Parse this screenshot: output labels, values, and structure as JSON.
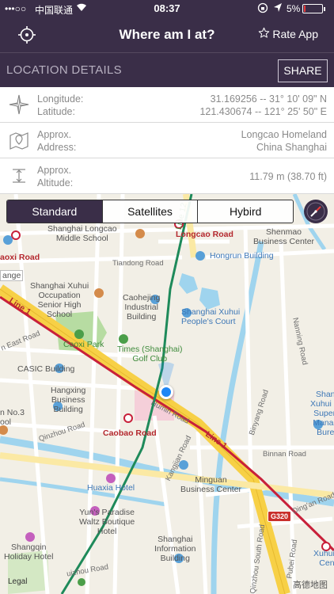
{
  "status_bar": {
    "signal": "•••○○",
    "carrier": "中国联通",
    "time": "08:37",
    "battery": "5%",
    "battery_level": 0.05
  },
  "nav": {
    "title": "Where am I at?",
    "rate_label": "Rate App"
  },
  "section": {
    "title": "LOCATION DETAILS",
    "share_label": "SHARE"
  },
  "details": {
    "coords": {
      "longitude_label": "Longitude:",
      "latitude_label": "Latitude:",
      "longitude_value": "31.169256 -- 31° 10' 09\" N",
      "latitude_value": "121.430674 -- 121° 25' 50\" E"
    },
    "address": {
      "label1": "Approx.",
      "label2": "Address:",
      "line1": "Longcao Homeland",
      "line2": "China Shanghai"
    },
    "altitude": {
      "label1": "Approx.",
      "label2": "Altitude:",
      "value": "11.79 m (38.70 ft)"
    }
  },
  "map": {
    "segments": [
      "Standard",
      "Satellites",
      "Hybird"
    ],
    "selected_segment": "Standard",
    "labels": {
      "longcao_school": "Shanghai Longcao\nMiddle School",
      "longcao_road_station": "Longcao Road",
      "shenmao": "Shenmao\nBusiness Center",
      "caoxi_road": "aoxi Road",
      "tiandong": "Tiandong Road",
      "hongrun": "Hongrun Building",
      "xuhui_occupation": "Shanghai Xuhui\nOccupation\nSenior High\nSchool",
      "caohejing": "Caohejing\nIndustrial\nBuilding",
      "peoples_court": "Shanghai Xuhui\nPeople's Court",
      "line1_top": "Line 1",
      "caoxi_park": "Caoxi Park",
      "times_golf": "Times (Shanghai)\nGolf Club",
      "east_road": "n East Road",
      "casic": "CASIC Building",
      "hangxing": "Hangxing\nBusiness\nBuilding",
      "no3": "n No.3\nool",
      "humin": "Humin Road",
      "caobao": "Caobao Road",
      "qinzhou": "Qinzhou Road",
      "binyang": "Binyang Road",
      "line1_bottom": "Line 1",
      "binnan": "Binnan Road",
      "nanning": "Nanning Road",
      "xuhui_superior": "Shan\nXuhui M\nSuperi\nManag\nBure",
      "huaxia": "Huaxia Hotel",
      "minguan": "Minguan\nBusiness Center",
      "kangjian": "Kangjian Road",
      "yuns": "Yun's Paradise\nWaltz Boutique\nHotel",
      "shanghai_info": "Shanghai\nInformation\nBuilding",
      "dingan": "Ding'an Road",
      "xuhui_vc": "Xuhui V\nCent",
      "shangqin": "Shangqin\nHoliday Hotel",
      "guizhou": "uizhou Road",
      "qinzhou_south": "Qinzhou South Road",
      "pubei": "Pubei Road",
      "line12": "Line 12",
      "range": "ange"
    },
    "shield": "G320",
    "legal": "Legal",
    "brand": "高德地图"
  },
  "colors": {
    "header_bg": "#3a2e48",
    "metro_line1": "#c8203a",
    "metro_line12": "#1e8a5a",
    "highway": "#f7d046",
    "water": "#9fd4ee",
    "park": "#b7dca2"
  }
}
